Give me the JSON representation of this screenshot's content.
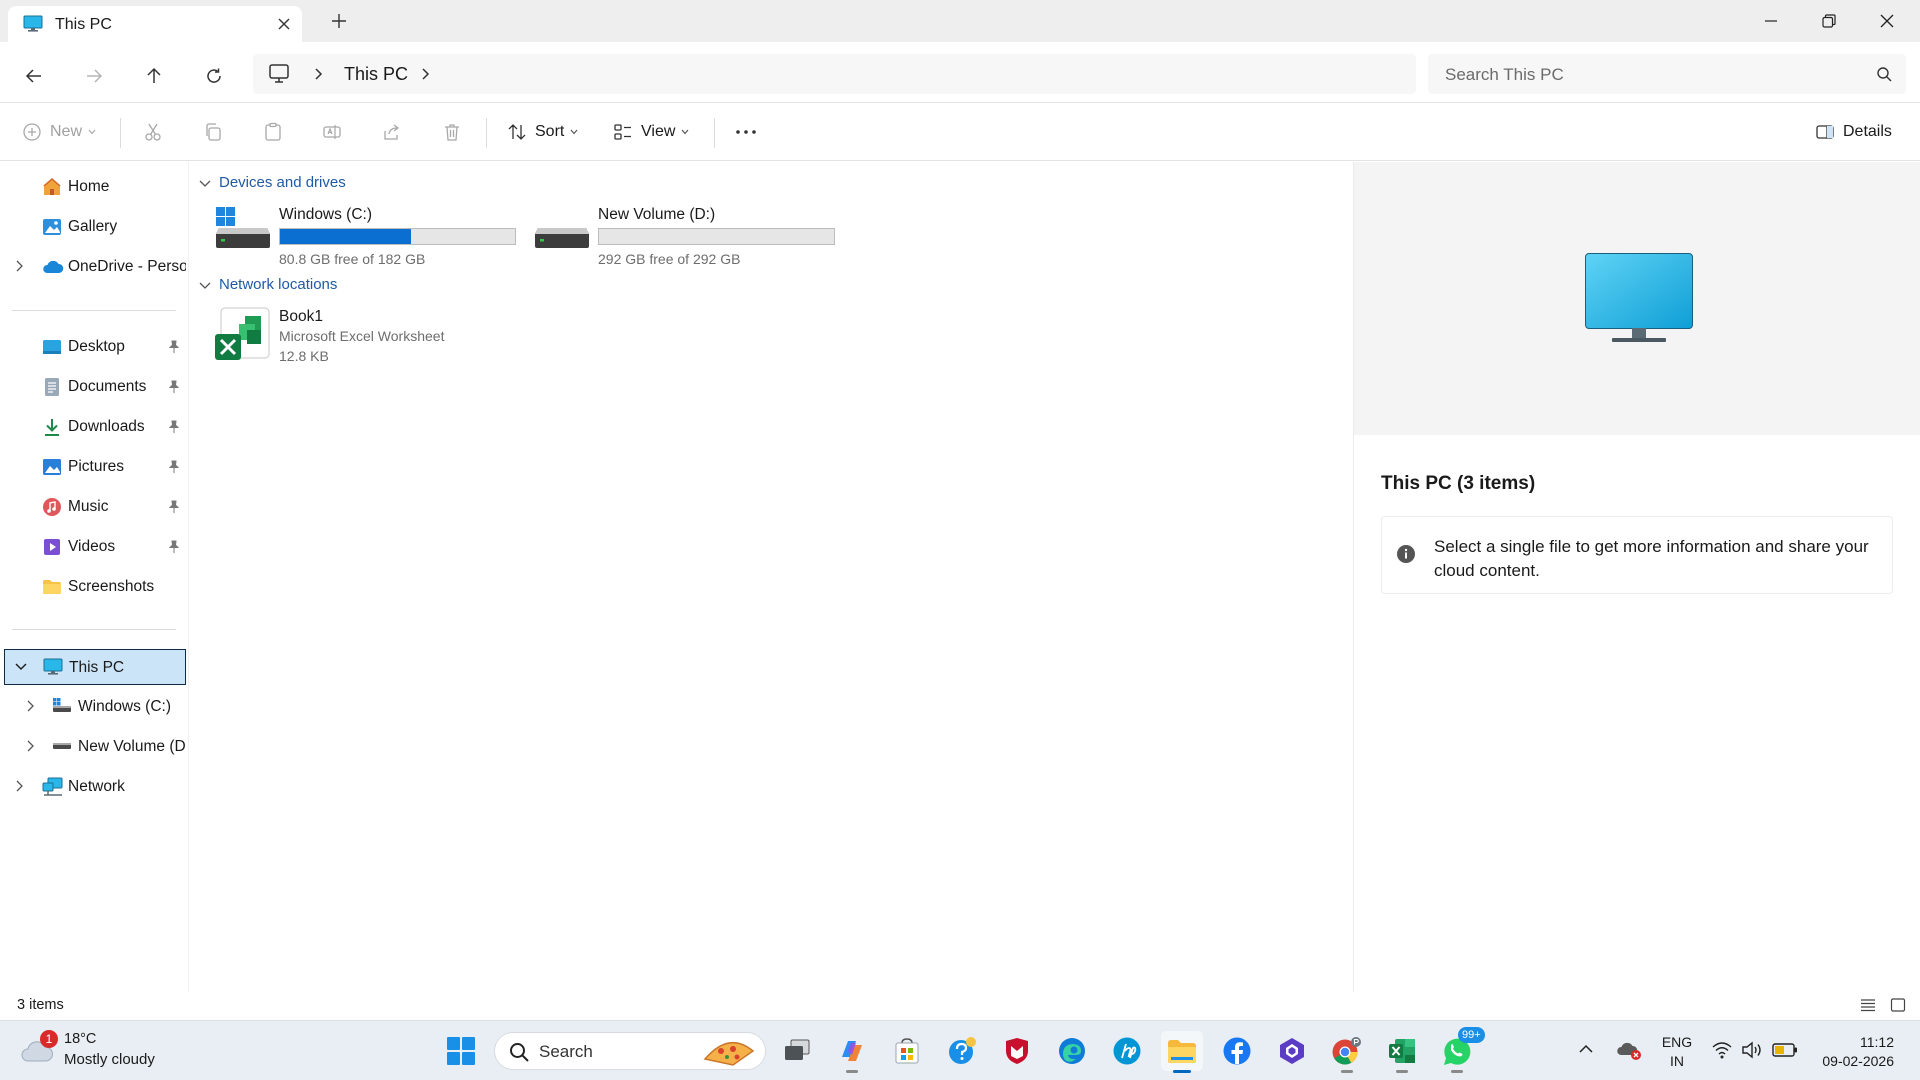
{
  "window": {
    "tab_title": "This PC",
    "accent": "#0067c0"
  },
  "address": {
    "crumb": "This PC",
    "search_placeholder": "Search This PC"
  },
  "commands": {
    "new": "New",
    "sort": "Sort",
    "view": "View",
    "details": "Details"
  },
  "sidebar": {
    "quick": [
      {
        "label": "Home",
        "icon": "home-icon"
      },
      {
        "label": "Gallery",
        "icon": "gallery-icon"
      },
      {
        "label": "OneDrive - Personal",
        "icon": "onedrive-icon"
      }
    ],
    "pinned": [
      {
        "label": "Desktop",
        "icon": "desktop-folder-icon"
      },
      {
        "label": "Documents",
        "icon": "documents-folder-icon"
      },
      {
        "label": "Downloads",
        "icon": "downloads-folder-icon"
      },
      {
        "label": "Pictures",
        "icon": "pictures-folder-icon"
      },
      {
        "label": "Music",
        "icon": "music-folder-icon"
      },
      {
        "label": "Videos",
        "icon": "videos-folder-icon"
      },
      {
        "label": "Screenshots",
        "icon": "folder-icon"
      }
    ],
    "tree": {
      "this_pc": "This PC",
      "windows_c": "Windows (C:)",
      "new_volume": "New Volume (D:)",
      "network": "Network"
    }
  },
  "content": {
    "devices_header": "Devices and drives",
    "network_header": "Network locations",
    "drives": [
      {
        "name": "Windows (C:)",
        "free": "80.8 GB free of 182 GB",
        "used_fraction": 0.556
      },
      {
        "name": "New Volume (D:)",
        "free": "292 GB free of 292 GB",
        "used_fraction": 0.0
      }
    ],
    "network_items": [
      {
        "name": "Book1",
        "type": "Microsoft Excel Worksheet",
        "size": "12.8 KB"
      }
    ]
  },
  "details_pane": {
    "title": "This PC (3 items)",
    "info": "Select a single file to get more information and share your cloud content."
  },
  "status": {
    "count": "3 items"
  },
  "taskbar": {
    "weather_temp": "18°C",
    "weather_cond": "Mostly cloudy",
    "weather_badge": "1",
    "search_label": "Search",
    "whatsapp_badge": "99+",
    "lang_top": "ENG",
    "lang_bottom": "IN",
    "time": "11:12",
    "date": "09-02-2026"
  }
}
